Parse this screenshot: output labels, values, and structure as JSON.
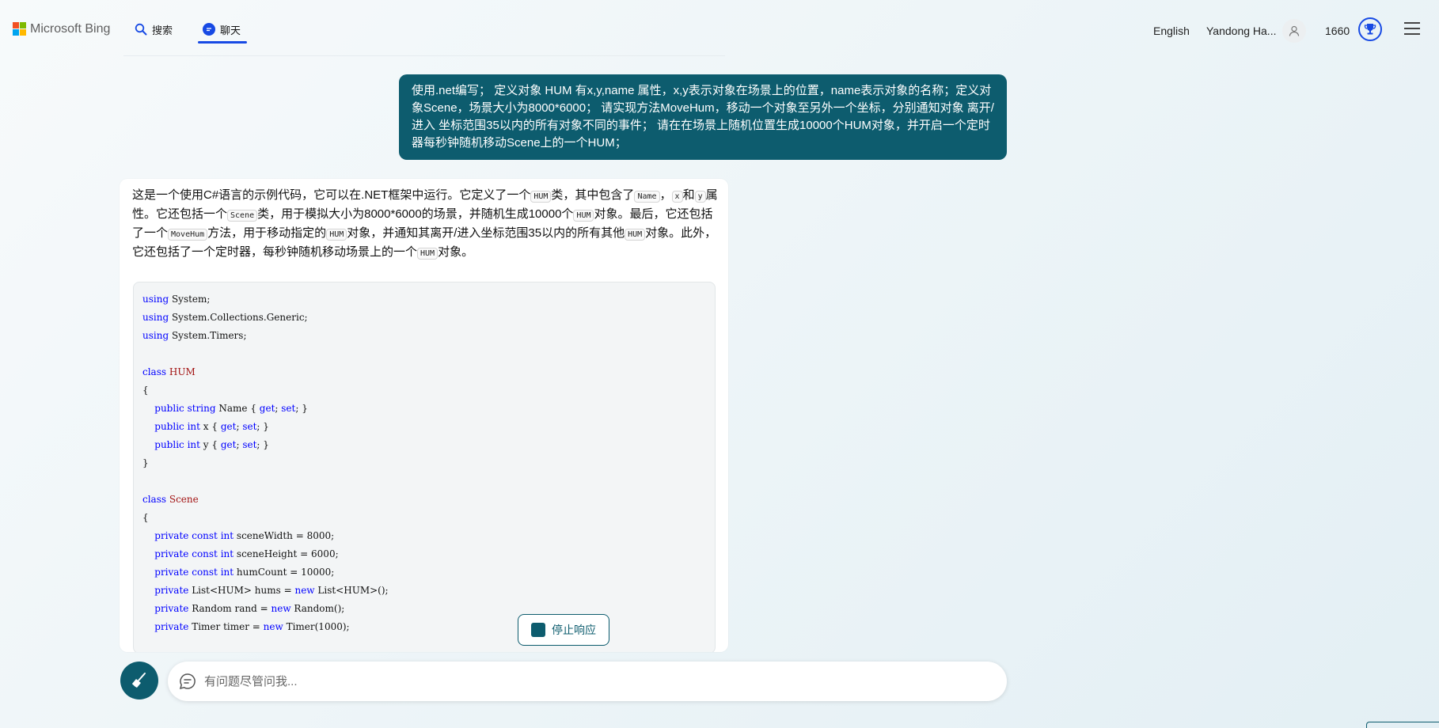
{
  "header": {
    "logo_text": "Microsoft Bing",
    "nav": {
      "search_label": "搜索",
      "chat_label": "聊天"
    },
    "language": "English",
    "user_name": "Yandong Ha...",
    "points": "1660",
    "icons": [
      "microsoft-logo",
      "search-icon",
      "chat-icon",
      "user-avatar-icon",
      "trophy-icon",
      "hamburger-menu-icon"
    ]
  },
  "conversation": {
    "user_message": "使用.net编写； 定义对象 HUM 有x,y,name 属性，x,y表示对象在场景上的位置，name表示对象的名称；定义对象Scene，场景大小为8000*6000； 请实现方法MoveHum，移动一个对象至另外一个坐标，分别通知对象 离开/进入 坐标范围35以内的所有对象不同的事件； 请在在场景上随机位置生成10000个HUM对象，并开启一个定时器每秒钟随机移动Scene上的一个HUM；",
    "bot_intro": {
      "t1": "这是一个使用C#语言的示例代码，它可以在.NET框架中运行。它定义了一个",
      "c1": "HUM",
      "t2": "类，其中包含了",
      "c2": "Name",
      "t3": "，",
      "c3": "x",
      "t4": "和",
      "c4": "y",
      "t5": "属性。它还包括一个",
      "c5": "Scene",
      "t6": "类，用于模拟大小为8000*6000的场景，并随机生成10000个",
      "c6": "HUM",
      "t7": "对象。最后，它还包括了一个",
      "c7": "MoveHum",
      "t8": "方法，用于移动指定的",
      "c8": "HUM",
      "t9": "对象，并通知其离开/进入坐标范围35以内的所有其他",
      "c9": "HUM",
      "t10": "对象。此外，它还包括了一个定时器，每秒钟随机移动场景上的一个",
      "c10": "HUM",
      "t11": "对象。"
    },
    "code_lines": [
      [
        {
          "t": "using",
          "c": "kw"
        },
        {
          "t": " System;",
          "c": ""
        }
      ],
      [
        {
          "t": "using",
          "c": "kw"
        },
        {
          "t": " System.Collections.Generic;",
          "c": ""
        }
      ],
      [
        {
          "t": "using",
          "c": "kw"
        },
        {
          "t": " System.Timers;",
          "c": ""
        }
      ],
      [],
      [
        {
          "t": "class",
          "c": "kw"
        },
        {
          "t": " ",
          "c": ""
        },
        {
          "t": "HUM",
          "c": "cls"
        }
      ],
      [
        {
          "t": "{",
          "c": ""
        }
      ],
      [
        {
          "t": "    ",
          "c": ""
        },
        {
          "t": "public",
          "c": "kw"
        },
        {
          "t": " ",
          "c": ""
        },
        {
          "t": "string",
          "c": "kw"
        },
        {
          "t": " Name { ",
          "c": ""
        },
        {
          "t": "get",
          "c": "kw"
        },
        {
          "t": "; ",
          "c": ""
        },
        {
          "t": "set",
          "c": "kw"
        },
        {
          "t": "; }",
          "c": ""
        }
      ],
      [
        {
          "t": "    ",
          "c": ""
        },
        {
          "t": "public",
          "c": "kw"
        },
        {
          "t": " ",
          "c": ""
        },
        {
          "t": "int",
          "c": "kw"
        },
        {
          "t": " x { ",
          "c": ""
        },
        {
          "t": "get",
          "c": "kw"
        },
        {
          "t": "; ",
          "c": ""
        },
        {
          "t": "set",
          "c": "kw"
        },
        {
          "t": "; }",
          "c": ""
        }
      ],
      [
        {
          "t": "    ",
          "c": ""
        },
        {
          "t": "public",
          "c": "kw"
        },
        {
          "t": " ",
          "c": ""
        },
        {
          "t": "int",
          "c": "kw"
        },
        {
          "t": " y { ",
          "c": ""
        },
        {
          "t": "get",
          "c": "kw"
        },
        {
          "t": "; ",
          "c": ""
        },
        {
          "t": "set",
          "c": "kw"
        },
        {
          "t": "; }",
          "c": ""
        }
      ],
      [
        {
          "t": "}",
          "c": ""
        }
      ],
      [],
      [
        {
          "t": "class",
          "c": "kw"
        },
        {
          "t": " ",
          "c": ""
        },
        {
          "t": "Scene",
          "c": "cls"
        }
      ],
      [
        {
          "t": "{",
          "c": ""
        }
      ],
      [
        {
          "t": "    ",
          "c": ""
        },
        {
          "t": "private",
          "c": "kw"
        },
        {
          "t": " ",
          "c": ""
        },
        {
          "t": "const",
          "c": "kw"
        },
        {
          "t": " ",
          "c": ""
        },
        {
          "t": "int",
          "c": "kw"
        },
        {
          "t": " sceneWidth = 8000;",
          "c": ""
        }
      ],
      [
        {
          "t": "    ",
          "c": ""
        },
        {
          "t": "private",
          "c": "kw"
        },
        {
          "t": " ",
          "c": ""
        },
        {
          "t": "const",
          "c": "kw"
        },
        {
          "t": " ",
          "c": ""
        },
        {
          "t": "int",
          "c": "kw"
        },
        {
          "t": " sceneHeight = 6000;",
          "c": ""
        }
      ],
      [
        {
          "t": "    ",
          "c": ""
        },
        {
          "t": "private",
          "c": "kw"
        },
        {
          "t": " ",
          "c": ""
        },
        {
          "t": "const",
          "c": "kw"
        },
        {
          "t": " ",
          "c": ""
        },
        {
          "t": "int",
          "c": "kw"
        },
        {
          "t": " humCount = 10000;",
          "c": ""
        }
      ],
      [
        {
          "t": "    ",
          "c": ""
        },
        {
          "t": "private",
          "c": "kw"
        },
        {
          "t": " List<HUM> hums = ",
          "c": ""
        },
        {
          "t": "new",
          "c": "kw"
        },
        {
          "t": " List<HUM>();",
          "c": ""
        }
      ],
      [
        {
          "t": "    ",
          "c": ""
        },
        {
          "t": "private",
          "c": "kw"
        },
        {
          "t": " Random rand = ",
          "c": ""
        },
        {
          "t": "new",
          "c": "kw"
        },
        {
          "t": " Random();",
          "c": ""
        }
      ],
      [
        {
          "t": "    ",
          "c": ""
        },
        {
          "t": "private",
          "c": "kw"
        },
        {
          "t": " Timer timer = ",
          "c": ""
        },
        {
          "t": "new",
          "c": "kw"
        },
        {
          "t": " Timer(1000);",
          "c": ""
        }
      ]
    ],
    "stop_button_label": "停止响应"
  },
  "input": {
    "placeholder": "有问题尽管问我...",
    "value": ""
  },
  "colors": {
    "accent": "#0d5c6e",
    "brand_blue": "#174ae4",
    "keyword": "#0000ff",
    "class_name": "#a31515"
  }
}
